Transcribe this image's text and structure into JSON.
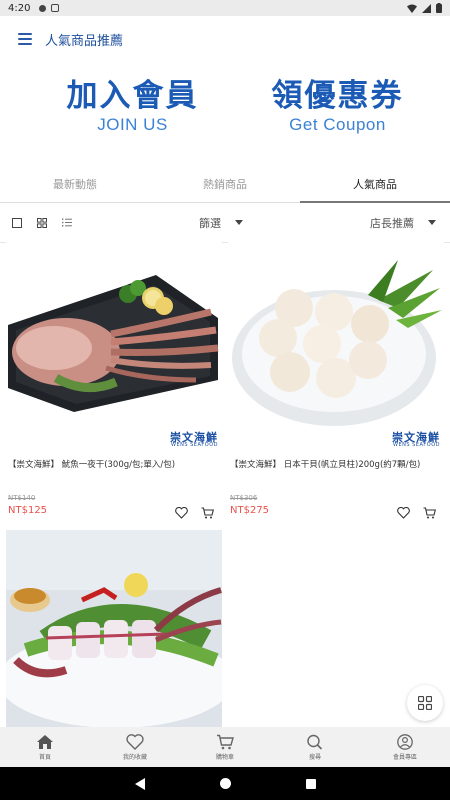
{
  "status_bar": {
    "time": "4:20"
  },
  "app_bar": {
    "title": "人氣商品推薦"
  },
  "banners": [
    {
      "title": "加入會員",
      "subtitle": "JOIN US"
    },
    {
      "title": "領優惠券",
      "subtitle": "Get Coupon"
    }
  ],
  "tabs": [
    {
      "label": "最新動態",
      "active": false
    },
    {
      "label": "熱銷商品",
      "active": false
    },
    {
      "label": "人氣商品",
      "active": true
    }
  ],
  "filter_bar": {
    "filter_label": "篩選",
    "sort_label": "店長推薦"
  },
  "products": [
    {
      "name": "【崇文海鮮】 魷魚一夜干(300g/包;單入/包)",
      "original_price": "NT$140",
      "price": "NT$125",
      "brand_cn": "崇文海鮮",
      "brand_en": "WENS SEAFOOD"
    },
    {
      "name": "【崇文海鮮】 日本干貝(帆立貝柱)200g(約7顆/包)",
      "original_price": "NT$306",
      "price": "NT$275",
      "brand_cn": "崇文海鮮",
      "brand_en": "WENS SEAFOOD"
    },
    {
      "name": "",
      "original_price": "",
      "price": "",
      "brand_cn": "",
      "brand_en": ""
    }
  ],
  "bottom_nav": [
    {
      "label": "首頁",
      "icon": "home-icon"
    },
    {
      "label": "我的收藏",
      "icon": "heart-icon"
    },
    {
      "label": "購物車",
      "icon": "cart-icon"
    },
    {
      "label": "搜尋",
      "icon": "search-icon"
    },
    {
      "label": "會員專區",
      "icon": "user-icon"
    }
  ],
  "colors": {
    "brand_blue": "#1b5bb6",
    "price_red": "#e7534b",
    "status_bar": "#ebebeb",
    "bottom_nav_bg": "#f1f1f1"
  }
}
